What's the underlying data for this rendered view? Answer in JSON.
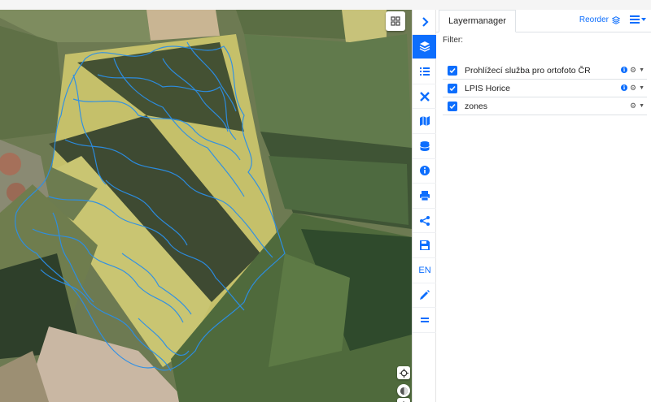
{
  "panel": {
    "tab_label": "Layermanager",
    "reorder_label": "Reorder",
    "filter_label": "Filter:"
  },
  "toolbar": {
    "lang_label": "EN"
  },
  "layers": [
    {
      "name": "Prohlížecí služba pro ortofoto ČR",
      "checked": true,
      "has_info": true
    },
    {
      "name": "LPIS Horice",
      "checked": true,
      "has_info": true
    },
    {
      "name": "zones",
      "checked": true,
      "has_info": false
    }
  ],
  "colors": {
    "accent": "#0d6efd",
    "zone_outline": "#2b8fe8"
  }
}
